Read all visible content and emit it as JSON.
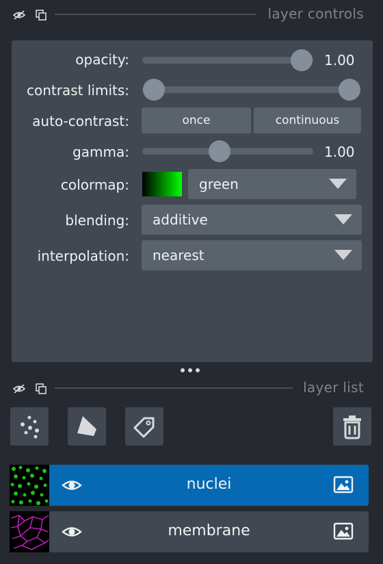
{
  "layer_controls": {
    "title": "layer controls",
    "opacity": {
      "label": "opacity:",
      "value": 1.0,
      "value_text": "1.00"
    },
    "contrast_limits": {
      "label": "contrast limits:",
      "low": 0.0,
      "high": 1.0
    },
    "auto_contrast": {
      "label": "auto-contrast:",
      "once_label": "once",
      "continuous_label": "continuous"
    },
    "gamma": {
      "label": "gamma:",
      "value": 1.0,
      "value_text": "1.00"
    },
    "colormap": {
      "label": "colormap:",
      "value": "green",
      "swatch_end_color": "#00ff00"
    },
    "blending": {
      "label": "blending:",
      "value": "additive"
    },
    "interpolation": {
      "label": "interpolation:",
      "value": "nearest"
    }
  },
  "layer_list": {
    "title": "layer list",
    "tools": [
      "new-points-layer",
      "new-shapes-layer",
      "new-labels-layer",
      "delete-layer"
    ],
    "layers": [
      {
        "name": "nuclei",
        "visible": true,
        "selected": true,
        "type": "image",
        "thumb_color": "#19c419"
      },
      {
        "name": "membrane",
        "visible": true,
        "selected": false,
        "type": "image",
        "thumb_color": "#b81fb8"
      }
    ]
  },
  "colors": {
    "background": "#262930",
    "panel": "#414851",
    "control": "#5a626c",
    "selected": "#0669b3"
  }
}
